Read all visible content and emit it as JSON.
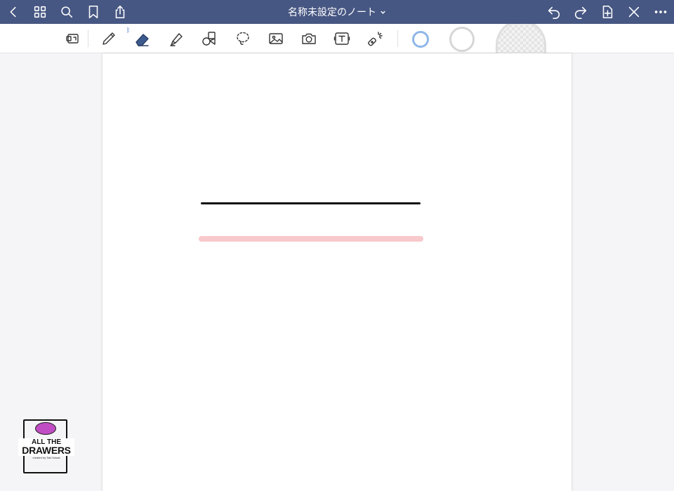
{
  "window": {
    "title": "名称未設定のノート"
  },
  "topbar": {
    "left_icons": [
      "chevron-left-icon",
      "grid-icon",
      "search-icon",
      "bookmark-icon",
      "share-icon"
    ],
    "right_icons": [
      "undo-icon",
      "redo-icon",
      "add-page-icon",
      "close-pen-icon",
      "more-icon"
    ]
  },
  "toolbar": {
    "tools": [
      "zoom-window-icon",
      "pen-icon",
      "eraser-icon",
      "highlighter-icon",
      "shapes-icon",
      "lasso-icon",
      "image-icon",
      "camera-icon",
      "text-box-icon",
      "laser-pointer-icon"
    ],
    "selected_tool": "eraser",
    "bluetooth_indicator": "ᛒ",
    "swatch_colors": [
      "#8fb7e8",
      "#d6d6d8",
      "#dedede"
    ]
  },
  "canvas": {
    "strokes": [
      {
        "type": "pen",
        "color": "#111111"
      },
      {
        "type": "highlighter",
        "color": "#f8c8cb"
      }
    ]
  },
  "watermark": {
    "line1": "ALL THE",
    "line2": "DRAWERS",
    "line3": "created by Sari Kawai",
    "brain_color": "#c04dc4"
  },
  "theme": {
    "topbar_bg": "#475783",
    "accent": "#3b6fc2"
  }
}
